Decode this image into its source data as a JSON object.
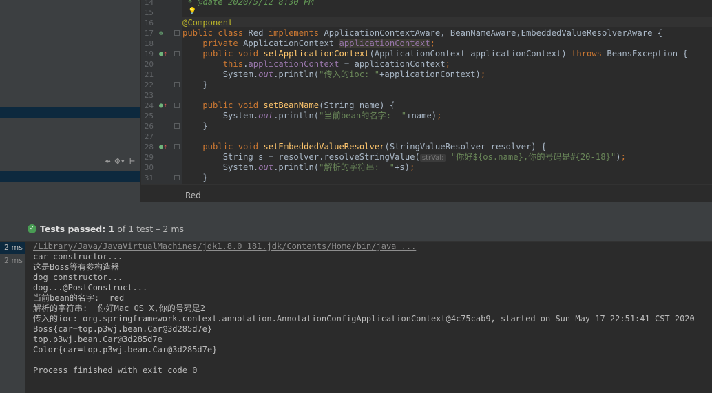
{
  "editor": {
    "lines": [
      {
        "n": "14"
      },
      {
        "n": "15"
      },
      {
        "n": "16"
      },
      {
        "n": "17"
      },
      {
        "n": "18"
      },
      {
        "n": "19"
      },
      {
        "n": "20"
      },
      {
        "n": "21"
      },
      {
        "n": "22"
      },
      {
        "n": "23"
      },
      {
        "n": "24"
      },
      {
        "n": "25"
      },
      {
        "n": "26"
      },
      {
        "n": "27"
      },
      {
        "n": "28"
      },
      {
        "n": "29"
      },
      {
        "n": "30"
      },
      {
        "n": "31"
      }
    ],
    "code": {
      "l14_doc": " * @date 2020/5/12 8:30 PM",
      "l16_ann": "@Component",
      "l17_a": "public class ",
      "l17_b": "Red ",
      "l17_c": "implements ",
      "l17_d": "ApplicationContextAware, BeanNameAware,EmbeddedValueResolverAware {",
      "l18_a": "    private ",
      "l18_b": "ApplicationContext ",
      "l18_c": "applicationContext",
      "l18_d": ";",
      "l19_a": "    public void ",
      "l19_b": "setApplicationContext",
      "l19_c": "(ApplicationContext applicationContext) ",
      "l19_d": "throws ",
      "l19_e": "BeansException {",
      "l20_a": "        this",
      "l20_b": ".",
      "l20_c": "applicationContext ",
      "l20_d": "= applicationContext",
      "l20_e": ";",
      "l21_a": "        System.",
      "l21_b": "out",
      "l21_c": ".println(",
      "l21_d": "\"传入的ioc: \"",
      "l21_e": "+applicationContext)",
      "l21_f": ";",
      "l22": "    }",
      "l24_a": "    public void ",
      "l24_b": "setBeanName",
      "l24_c": "(String name) {",
      "l25_a": "        System.",
      "l25_b": "out",
      "l25_c": ".println(",
      "l25_d": "\"当前bean的名字:  \"",
      "l25_e": "+name)",
      "l25_f": ";",
      "l26": "    }",
      "l28_a": "    public void ",
      "l28_b": "setEmbeddedValueResolver",
      "l28_c": "(StringValueResolver resolver) {",
      "l29_a": "        String s = resolver.resolveStringValue(",
      "l29_hint": "strVal:",
      "l29_b": " \"你好${os.name},你的号码是#{20-18}\"",
      "l29_c": ")",
      "l29_d": ";",
      "l30_a": "        System.",
      "l30_b": "out",
      "l30_c": ".println(",
      "l30_d": "\"解析的字符串:  \"",
      "l30_e": "+s)",
      "l30_f": ";",
      "l31": "    }"
    }
  },
  "breadcrumb": {
    "class_name": "Red"
  },
  "run": {
    "status_prefix": "Tests passed: ",
    "status_count": "1",
    "status_suffix": " of 1 test – 2 ms",
    "tree": [
      {
        "time": "2 ms"
      },
      {
        "time": "2 ms"
      }
    ],
    "console": [
      "/Library/Java/JavaVirtualMachines/jdk1.8.0_181.jdk/Contents/Home/bin/java ...",
      "car constructor...",
      "这是Boss等有参构造器",
      "dog constructor...",
      "dog...@PostConstruct...",
      "当前bean的名字:  red",
      "解析的字符串:  你好Mac OS X,你的号码是2",
      "传入的ioc: org.springframework.context.annotation.AnnotationConfigApplicationContext@4c75cab9, started on Sun May 17 22:51:41 CST 2020",
      "Boss{car=top.p3wj.bean.Car@3d285d7e}",
      "top.p3wj.bean.Car@3d285d7e",
      "Color{car=top.p3wj.bean.Car@3d285d7e}",
      "",
      "Process finished with exit code 0"
    ]
  },
  "colors": {
    "keyword": "#cc7832",
    "annotation": "#bbb529",
    "method": "#ffc66d",
    "field": "#9876aa",
    "string": "#6a8759",
    "pass": "#499c54",
    "selection": "#0d293e"
  },
  "icons": {
    "toolbar": [
      "expand-icon",
      "gear-icon",
      "collapse-icon"
    ],
    "gutter": [
      "implement-icon",
      "bean-icon",
      "bulb-icon"
    ]
  }
}
